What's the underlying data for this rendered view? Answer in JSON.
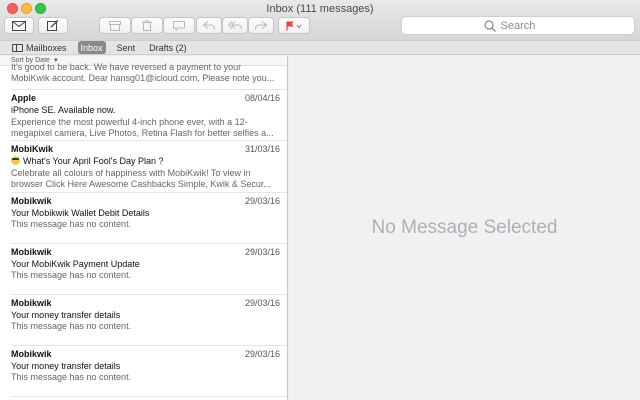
{
  "window": {
    "title": "Inbox (111 messages)"
  },
  "search": {
    "placeholder": "Search"
  },
  "favorites": {
    "mailboxes": "Mailboxes",
    "inbox": "Inbox",
    "sent": "Sent",
    "drafts": "Drafts (2)"
  },
  "list": {
    "sort_label": "Sort by Date",
    "messages": [
      {
        "sender": "",
        "date": "",
        "subject": "",
        "preview": "It's good to be back. We have reversed a payment to your MobiKwik account. Dear hansg01@icloud.com, Please note you..."
      },
      {
        "sender": "Apple",
        "date": "08/04/16",
        "subject": "iPhone SE. Available now.",
        "preview": "Experience the most powerful 4-inch phone ever, with a 12-megapixel camera, Live Photos, Retina Flash for better selfies a..."
      },
      {
        "sender": "MobiKwik",
        "date": "31/03/16",
        "subject": "What's Your April Fool's Day Plan ?",
        "preview": "Celebrate all colours of happiness with MobiKwik! To view in browser Click Here Awesome Cashbacks Simple, Kwik & Secur..."
      },
      {
        "sender": "Mobikwik",
        "date": "29/03/16",
        "subject": "Your Mobikwik Wallet Debit Details",
        "preview": "This message has no content."
      },
      {
        "sender": "Mobikwik",
        "date": "29/03/16",
        "subject": "Your MobiKwik Payment Update",
        "preview": "This message has no content."
      },
      {
        "sender": "Mobikwik",
        "date": "29/03/16",
        "subject": "Your money transfer details",
        "preview": "This message has no content."
      },
      {
        "sender": "Mobikwik",
        "date": "29/03/16",
        "subject": "Your money transfer details",
        "preview": "This message has no content."
      }
    ]
  },
  "reader": {
    "empty_text": "No Message Selected"
  },
  "colors": {
    "close": "#fc605b",
    "minimize": "#fdbc40",
    "maximize": "#34c84a",
    "flag": "#e8453c"
  }
}
